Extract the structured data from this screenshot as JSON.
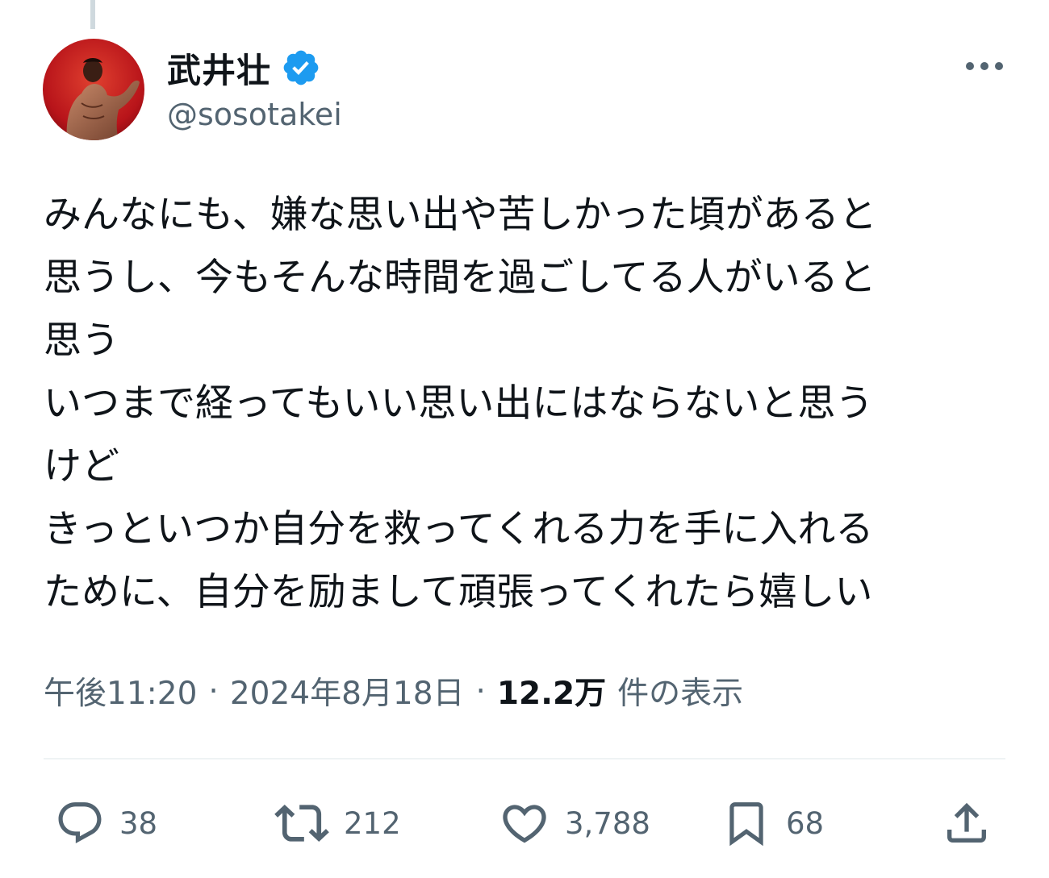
{
  "author": {
    "display_name": "武井壮",
    "handle": "@sosotakei",
    "verified_color": "#1d9bf0"
  },
  "tweet": {
    "lines": [
      "みんなにも、嫌な思い出や苦しかった頃があると",
      "思うし、今もそんな時間を過ごしてる人がいると",
      "思う",
      "いつまで経ってもいい思い出にはならないと思う",
      "けど",
      "きっといつか自分を救ってくれる力を手に入れる",
      "ために、自分を励まして頑張ってくれたら嬉しい"
    ]
  },
  "meta": {
    "time": "午後11:20",
    "separator": "·",
    "date": "2024年8月18日",
    "views_count": "12.2万",
    "views_label": "件の表示"
  },
  "actions": {
    "replies": "38",
    "retweets": "212",
    "likes": "3,788",
    "bookmarks": "68"
  },
  "icons": {
    "reply": "reply-icon",
    "retweet": "retweet-icon",
    "like": "heart-icon",
    "bookmark": "bookmark-icon",
    "share": "share-icon",
    "more": "more-icon",
    "verified": "verified-badge-icon"
  },
  "colors": {
    "text": "#0f1419",
    "secondary": "#536471",
    "divider": "#eff3f4",
    "verified": "#1d9bf0"
  }
}
